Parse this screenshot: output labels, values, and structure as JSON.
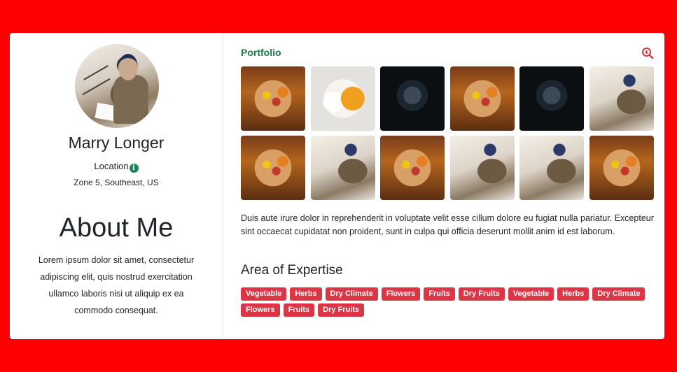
{
  "profile": {
    "name": "Marry Longer",
    "location_label": "Location",
    "location_icon": "info-icon",
    "location_value": "Zone 5, Southeast, US"
  },
  "about": {
    "title": "About Me",
    "text": "Lorem ipsum dolor sit amet, consectetur adipiscing elit, quis nostrud exercitation ullamco laboris nisi ut aliquip ex ea commodo consequat."
  },
  "portfolio": {
    "title": "Portfolio",
    "zoom_icon": "zoom-in-icon",
    "images": [
      "burrito",
      "curry",
      "plate",
      "burrito",
      "plate",
      "woman",
      "burrito",
      "woman",
      "burrito",
      "woman",
      "woman",
      "burrito"
    ],
    "description": "Duis aute irure dolor in reprehenderit in voluptate velit esse cillum dolore eu fugiat nulla pariatur. Excepteur sint occaecat cupidatat non proident, sunt in culpa qui officia deserunt mollit anim id est laborum."
  },
  "expertise": {
    "title": "Area of Expertise",
    "tags": [
      "Vegetable",
      "Herbs",
      "Dry Climate",
      "Flowers",
      "Fruits",
      "Dry Fruits",
      "Vegetable",
      "Herbs",
      "Dry Climate",
      "Flowers",
      "Fruits",
      "Dry Fruits"
    ]
  },
  "colors": {
    "background": "#ff0000",
    "accent_green": "#1b7a4a",
    "tag_red": "#dc3545"
  }
}
